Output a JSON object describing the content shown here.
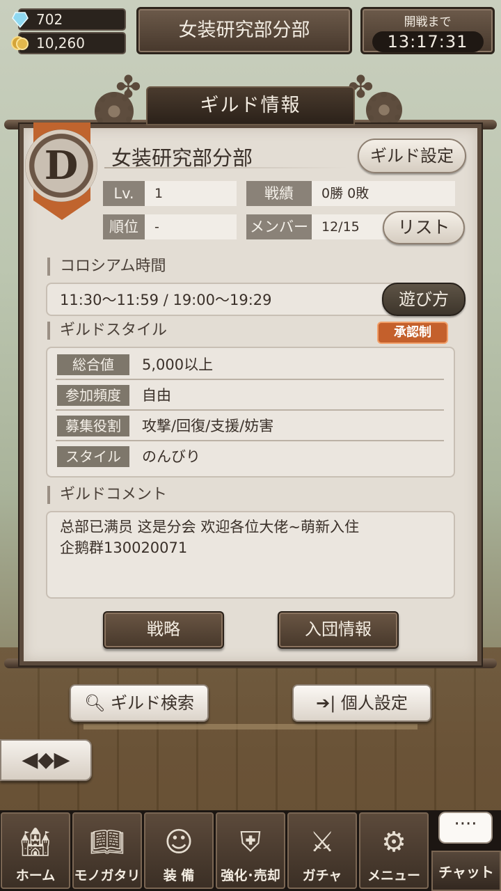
{
  "currency": {
    "crystal": "702",
    "coins": "10,260"
  },
  "top": {
    "guild_name": "女装研究部分部",
    "battle_label": "開戦まで",
    "battle_timer": "13:17:31"
  },
  "panel_title": "ギルド情報",
  "emblem_letter": "D",
  "guild": {
    "name": "女装研究部分部",
    "settings_button": "ギルド設定",
    "lv_label": "Lv.",
    "lv_value": "1",
    "record_label": "戦績",
    "record_value": "0勝 0敗",
    "rank_label": "順位",
    "rank_value": "-",
    "member_label": "メンバー",
    "member_value": "12/15",
    "list_button": "リスト"
  },
  "colosseum": {
    "heading": "コロシアム時間",
    "time": "11:30〜11:59 / 19:00〜19:29",
    "howto_button": "遊び方"
  },
  "style": {
    "heading": "ギルドスタイル",
    "badge": "承認制",
    "rows": [
      {
        "key": "総合値",
        "value": "5,000以上"
      },
      {
        "key": "参加頻度",
        "value": "自由"
      },
      {
        "key": "募集役割",
        "value": "攻撃/回復/支援/妨害"
      },
      {
        "key": "スタイル",
        "value": "のんびり"
      }
    ]
  },
  "comment": {
    "heading": "ギルドコメント",
    "line1": "总部已满员 这是分会 欢迎各位大佬~萌新入住",
    "line2": "企鹅群130020071"
  },
  "actions": {
    "strategy": "戦略",
    "join_info": "入団情報",
    "guild_search": "ギルド検索",
    "personal_settings": "個人設定"
  },
  "nav": {
    "home": "ホーム",
    "story": "モノガタリ",
    "equip": "装 備",
    "enhance": "強化･売却",
    "gacha": "ガチャ",
    "menu": "メニュー",
    "chat": "チャット",
    "chat_bubble": "····"
  },
  "icons": {
    "back": "back-arrow-icon",
    "search": "search-icon",
    "personal": "arrow-into-bar-icon"
  }
}
